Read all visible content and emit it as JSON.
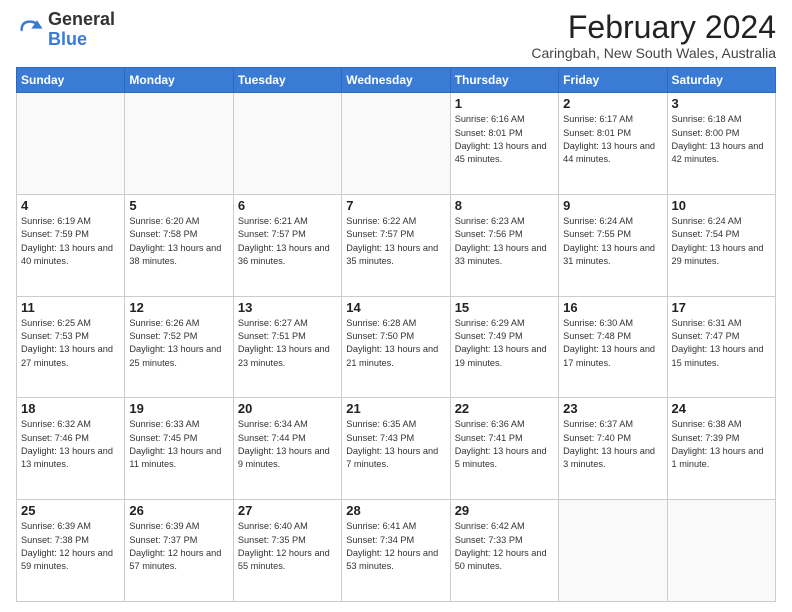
{
  "logo": {
    "general": "General",
    "blue": "Blue"
  },
  "header": {
    "month": "February 2024",
    "location": "Caringbah, New South Wales, Australia"
  },
  "days_of_week": [
    "Sunday",
    "Monday",
    "Tuesday",
    "Wednesday",
    "Thursday",
    "Friday",
    "Saturday"
  ],
  "weeks": [
    [
      {
        "day": "",
        "info": ""
      },
      {
        "day": "",
        "info": ""
      },
      {
        "day": "",
        "info": ""
      },
      {
        "day": "",
        "info": ""
      },
      {
        "day": "1",
        "info": "Sunrise: 6:16 AM\nSunset: 8:01 PM\nDaylight: 13 hours\nand 45 minutes."
      },
      {
        "day": "2",
        "info": "Sunrise: 6:17 AM\nSunset: 8:01 PM\nDaylight: 13 hours\nand 44 minutes."
      },
      {
        "day": "3",
        "info": "Sunrise: 6:18 AM\nSunset: 8:00 PM\nDaylight: 13 hours\nand 42 minutes."
      }
    ],
    [
      {
        "day": "4",
        "info": "Sunrise: 6:19 AM\nSunset: 7:59 PM\nDaylight: 13 hours\nand 40 minutes."
      },
      {
        "day": "5",
        "info": "Sunrise: 6:20 AM\nSunset: 7:58 PM\nDaylight: 13 hours\nand 38 minutes."
      },
      {
        "day": "6",
        "info": "Sunrise: 6:21 AM\nSunset: 7:57 PM\nDaylight: 13 hours\nand 36 minutes."
      },
      {
        "day": "7",
        "info": "Sunrise: 6:22 AM\nSunset: 7:57 PM\nDaylight: 13 hours\nand 35 minutes."
      },
      {
        "day": "8",
        "info": "Sunrise: 6:23 AM\nSunset: 7:56 PM\nDaylight: 13 hours\nand 33 minutes."
      },
      {
        "day": "9",
        "info": "Sunrise: 6:24 AM\nSunset: 7:55 PM\nDaylight: 13 hours\nand 31 minutes."
      },
      {
        "day": "10",
        "info": "Sunrise: 6:24 AM\nSunset: 7:54 PM\nDaylight: 13 hours\nand 29 minutes."
      }
    ],
    [
      {
        "day": "11",
        "info": "Sunrise: 6:25 AM\nSunset: 7:53 PM\nDaylight: 13 hours\nand 27 minutes."
      },
      {
        "day": "12",
        "info": "Sunrise: 6:26 AM\nSunset: 7:52 PM\nDaylight: 13 hours\nand 25 minutes."
      },
      {
        "day": "13",
        "info": "Sunrise: 6:27 AM\nSunset: 7:51 PM\nDaylight: 13 hours\nand 23 minutes."
      },
      {
        "day": "14",
        "info": "Sunrise: 6:28 AM\nSunset: 7:50 PM\nDaylight: 13 hours\nand 21 minutes."
      },
      {
        "day": "15",
        "info": "Sunrise: 6:29 AM\nSunset: 7:49 PM\nDaylight: 13 hours\nand 19 minutes."
      },
      {
        "day": "16",
        "info": "Sunrise: 6:30 AM\nSunset: 7:48 PM\nDaylight: 13 hours\nand 17 minutes."
      },
      {
        "day": "17",
        "info": "Sunrise: 6:31 AM\nSunset: 7:47 PM\nDaylight: 13 hours\nand 15 minutes."
      }
    ],
    [
      {
        "day": "18",
        "info": "Sunrise: 6:32 AM\nSunset: 7:46 PM\nDaylight: 13 hours\nand 13 minutes."
      },
      {
        "day": "19",
        "info": "Sunrise: 6:33 AM\nSunset: 7:45 PM\nDaylight: 13 hours\nand 11 minutes."
      },
      {
        "day": "20",
        "info": "Sunrise: 6:34 AM\nSunset: 7:44 PM\nDaylight: 13 hours\nand 9 minutes."
      },
      {
        "day": "21",
        "info": "Sunrise: 6:35 AM\nSunset: 7:43 PM\nDaylight: 13 hours\nand 7 minutes."
      },
      {
        "day": "22",
        "info": "Sunrise: 6:36 AM\nSunset: 7:41 PM\nDaylight: 13 hours\nand 5 minutes."
      },
      {
        "day": "23",
        "info": "Sunrise: 6:37 AM\nSunset: 7:40 PM\nDaylight: 13 hours\nand 3 minutes."
      },
      {
        "day": "24",
        "info": "Sunrise: 6:38 AM\nSunset: 7:39 PM\nDaylight: 13 hours\nand 1 minute."
      }
    ],
    [
      {
        "day": "25",
        "info": "Sunrise: 6:39 AM\nSunset: 7:38 PM\nDaylight: 12 hours\nand 59 minutes."
      },
      {
        "day": "26",
        "info": "Sunrise: 6:39 AM\nSunset: 7:37 PM\nDaylight: 12 hours\nand 57 minutes."
      },
      {
        "day": "27",
        "info": "Sunrise: 6:40 AM\nSunset: 7:35 PM\nDaylight: 12 hours\nand 55 minutes."
      },
      {
        "day": "28",
        "info": "Sunrise: 6:41 AM\nSunset: 7:34 PM\nDaylight: 12 hours\nand 53 minutes."
      },
      {
        "day": "29",
        "info": "Sunrise: 6:42 AM\nSunset: 7:33 PM\nDaylight: 12 hours\nand 50 minutes."
      },
      {
        "day": "",
        "info": ""
      },
      {
        "day": "",
        "info": ""
      }
    ]
  ]
}
